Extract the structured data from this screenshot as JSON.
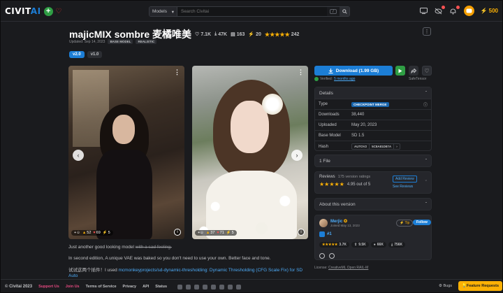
{
  "header": {
    "logo_prefix": "CIVIT",
    "logo_ai": "AI",
    "search_category": "Models",
    "search_placeholder": "Search Civitai",
    "search_shortcut": "/",
    "buzz_amount": "500"
  },
  "model": {
    "title": "majicMIX sombre 麦橘唯美",
    "stats": {
      "likes": "7.1K",
      "downloads": "47K",
      "comments": "163",
      "buzz": "20",
      "rating_count": "242"
    },
    "updated": "Updated: Sep 14, 2023",
    "base_model_tag": "BASE MODEL",
    "style_tag": "REALISTIC",
    "versions": [
      "v2.0",
      "v1.0"
    ]
  },
  "gallery": [
    {
      "reactions": {
        "likes": "52",
        "hearts": "69",
        "buzz": "5"
      }
    },
    {
      "reactions": {
        "likes": "37",
        "hearts": "71",
        "buzz": "5"
      }
    }
  ],
  "description": {
    "line1_plain": "Just another good looking model ",
    "line1_strike": "with a sad feeling.",
    "line2": "In second edition, A unique VAE was baked so you don't need to use your own. Better face and tone.",
    "line3_prefix": "试试这两个插件！I used ",
    "line3_link": "mcmonkeyprojects/sd-dynamic-thresholding: Dynamic Thresholding (CFG Scale Fix) for SD Auto"
  },
  "sidebar": {
    "download_label": "Download (1.99 GB)",
    "verified_text": "Verified: ",
    "verified_link": "5 months ago",
    "file_type": "SafeTensor",
    "details_title": "Details",
    "details": {
      "type_label": "Type",
      "type_value": "CHECKPOINT MERGE",
      "downloads_label": "Downloads",
      "downloads_value": "38,440",
      "uploaded_label": "Uploaded",
      "uploaded_value": "May 20, 2023",
      "base_label": "Base Model",
      "base_value": "SD 1.5",
      "hash_label": "Hash",
      "hash_algo": "AUTOV2",
      "hash_value": "5C8A81D87A"
    },
    "files_title": "1 File",
    "reviews_title": "Reviews",
    "reviews_count": "175 version ratings",
    "reviews_score": "4.95 out of 5",
    "add_review": "Add Review",
    "see_reviews": "See Reviews",
    "about_title": "About this version",
    "creator": {
      "name": "Merjic",
      "joined": "Joined May 13, 2023",
      "tip": "Tip",
      "follow": "Follow",
      "rank": "#1",
      "stats": [
        "3.7K",
        "9.5K",
        "66K",
        "756K"
      ]
    },
    "license_prefix": "License: ",
    "license_link": "CreativeML Open RAIL-M"
  },
  "footer": {
    "copyright": "© Civitai 2023",
    "support": "Support Us",
    "join": "Join Us",
    "terms": "Terms of Service",
    "privacy": "Privacy",
    "api": "API",
    "status": "Status",
    "bugs": "Bugs",
    "feature": "Feature Requests"
  },
  "colors": {
    "accent": "#1c7ed6",
    "background": "#1a1b1e",
    "star": "#fab005"
  }
}
